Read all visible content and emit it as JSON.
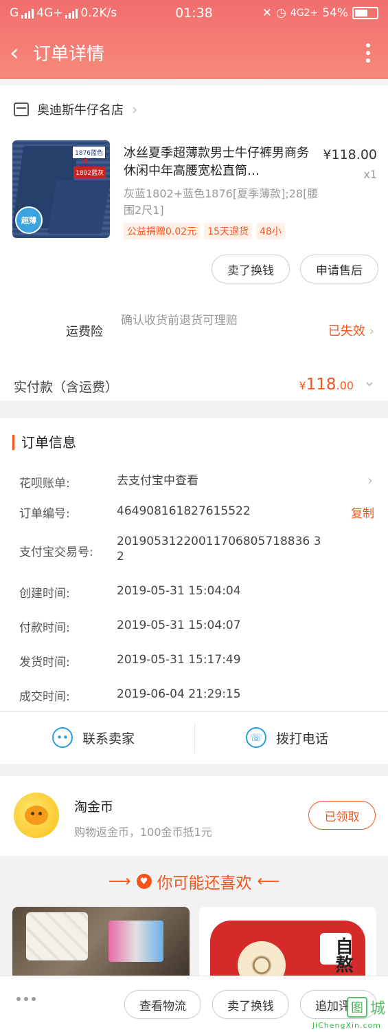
{
  "status_bar": {
    "network_left": "G",
    "network_4g": "4G+",
    "speed": "0.2K/s",
    "time": "01:38",
    "network_right": "4G2+",
    "battery": "54%"
  },
  "nav": {
    "title": "订单详情"
  },
  "shop": {
    "name": "奥迪斯牛仔名店"
  },
  "product": {
    "image_tag_blue": "1876蓝色",
    "image_plus": "+",
    "image_tag_red": "1802蓝灰",
    "image_badge": "超薄",
    "title": "冰丝夏季超薄款男士牛仔裤男商务休闲中年高腰宽松直筒…",
    "price": "¥118.00",
    "quantity": "x1",
    "sku": "灰蓝1802+蓝色1876[夏季薄款];28[腰围2尺1]",
    "tags": [
      "公益捐赠0.02元",
      "15天退货",
      "48小"
    ]
  },
  "item_actions": {
    "sell_exchange": "卖了换钱",
    "after_sale": "申请售后"
  },
  "insurance": {
    "title": "运费险",
    "desc": "确认收货前退货可理赔",
    "status": "已失效"
  },
  "payment": {
    "label": "实付款（含运费）",
    "currency": "¥",
    "integer": "118",
    "decimal": ".00"
  },
  "order_info": {
    "title": "订单信息",
    "rows": [
      {
        "label": "花呗账单:",
        "value": "去支付宝中查看",
        "action": ""
      },
      {
        "label": "订单编号:",
        "value": "464908161827615522",
        "action": "复制"
      },
      {
        "label": "支付宝交易号:",
        "value": "20190531220011706805718836 32",
        "action": ""
      },
      {
        "label": "创建时间:",
        "value": "2019-05-31 15:04:04",
        "action": ""
      },
      {
        "label": "付款时间:",
        "value": "2019-05-31 15:04:07",
        "action": ""
      },
      {
        "label": "发货时间:",
        "value": "2019-05-31 15:17:49",
        "action": ""
      },
      {
        "label": "成交时间:",
        "value": "2019-06-04 21:29:15",
        "action": ""
      }
    ]
  },
  "contact": {
    "seller": "联系卖家",
    "phone": "拨打电话"
  },
  "coins": {
    "title": "淘金币",
    "desc": "购物返金币，100金币抵1元",
    "button": "已领取"
  },
  "recommend": {
    "title": "你可能还喜欢",
    "card2_text": "自熬"
  },
  "bottom": {
    "logistics": "查看物流",
    "sell_exchange": "卖了换钱",
    "add_review": "追加评价"
  },
  "watermark": {
    "icon": "图",
    "text": "城",
    "sub": "JiChengXin.com"
  },
  "colors": {
    "header": "#f26d6d",
    "accent": "#f5541c",
    "contact_icon": "#2a9ce0"
  }
}
